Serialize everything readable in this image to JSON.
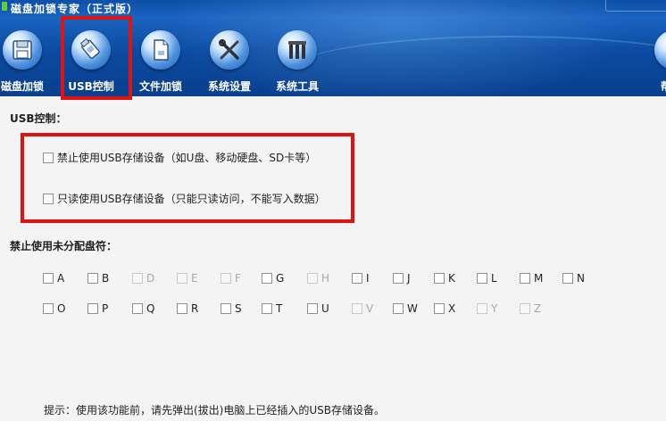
{
  "window": {
    "title": "磁盘加锁专家（正式版）"
  },
  "toolbar": {
    "items": [
      {
        "label": "磁盘加锁",
        "icon": "floppy-disk-icon"
      },
      {
        "label": "USB控制",
        "icon": "usb-drive-icon",
        "selected": true
      },
      {
        "label": "文件加锁",
        "icon": "file-lock-icon"
      },
      {
        "label": "系统设置",
        "icon": "wrench-screwdriver-icon"
      },
      {
        "label": "系统工具",
        "icon": "tools-icon"
      },
      {
        "label": "帮",
        "icon": "help-icon"
      }
    ]
  },
  "usb": {
    "section_label": "USB控制：",
    "options": [
      {
        "label": "禁止使用USB存储设备（如U盘、移动硬盘、SD卡等）",
        "checked": false
      },
      {
        "label": "只读使用USB存储设备（只能只读访问，不能写入数据）",
        "checked": false
      }
    ]
  },
  "drives": {
    "section_label": "禁止使用未分配盘符：",
    "row1": [
      {
        "letter": "A",
        "enabled": true
      },
      {
        "letter": "B",
        "enabled": true
      },
      {
        "letter": "D",
        "enabled": false
      },
      {
        "letter": "E",
        "enabled": false
      },
      {
        "letter": "F",
        "enabled": false
      },
      {
        "letter": "G",
        "enabled": true
      },
      {
        "letter": "H",
        "enabled": false
      },
      {
        "letter": "I",
        "enabled": true
      },
      {
        "letter": "J",
        "enabled": true
      },
      {
        "letter": "K",
        "enabled": true
      },
      {
        "letter": "L",
        "enabled": true
      },
      {
        "letter": "M",
        "enabled": true
      },
      {
        "letter": "N",
        "enabled": true
      }
    ],
    "row2": [
      {
        "letter": "O",
        "enabled": true
      },
      {
        "letter": "P",
        "enabled": true
      },
      {
        "letter": "Q",
        "enabled": true
      },
      {
        "letter": "R",
        "enabled": true
      },
      {
        "letter": "S",
        "enabled": true
      },
      {
        "letter": "T",
        "enabled": true
      },
      {
        "letter": "U",
        "enabled": true
      },
      {
        "letter": "V",
        "enabled": false
      },
      {
        "letter": "W",
        "enabled": true
      },
      {
        "letter": "X",
        "enabled": true
      },
      {
        "letter": "Y",
        "enabled": false
      },
      {
        "letter": "Z",
        "enabled": false
      }
    ]
  },
  "tip": "提示：使用该功能前，请先弹出(拔出)电脑上已经插入的USB存储设备。",
  "colors": {
    "highlight": "#e01313",
    "toolbar": "#0d4fa8"
  }
}
